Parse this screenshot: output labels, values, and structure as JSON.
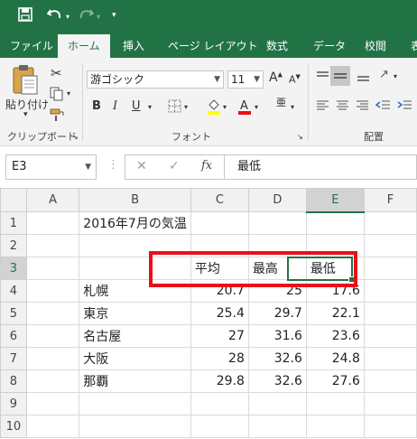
{
  "qat": {
    "save_icon": "save-icon",
    "undo_icon": "undo-icon",
    "redo_icon": "redo-icon",
    "customize_icon": "customize-icon"
  },
  "tabs": [
    {
      "label": "ファイル"
    },
    {
      "label": "ホーム"
    },
    {
      "label": "挿入"
    },
    {
      "label": "ページ レイアウト"
    },
    {
      "label": "数式"
    },
    {
      "label": "データ"
    },
    {
      "label": "校閲"
    },
    {
      "label": "表"
    }
  ],
  "ribbon": {
    "clipboard": {
      "paste_label": "貼り付け",
      "group_label": "クリップボード"
    },
    "font": {
      "font_name": "游ゴシック",
      "font_size": "11",
      "group_label": "フォント",
      "bold": "B",
      "italic": "I",
      "underline": "U",
      "grow": "A",
      "shrink": "A",
      "phonetic": "亜"
    },
    "alignment": {
      "group_label": "配置"
    }
  },
  "formula_bar": {
    "name_box": "E3",
    "cancel": "✕",
    "enter": "✓",
    "fx": "fx",
    "content": "最低"
  },
  "sheet": {
    "columns": [
      "A",
      "B",
      "C",
      "D",
      "E",
      "F"
    ],
    "rows": [
      "1",
      "2",
      "3",
      "4",
      "5",
      "6",
      "7",
      "8",
      "9",
      "10"
    ],
    "title": "2016年7月の気温",
    "headers": [
      "平均",
      "最高",
      "最低"
    ],
    "data": [
      {
        "city": "札幌",
        "avg": "20.7",
        "max": "25",
        "min": "17.6"
      },
      {
        "city": "東京",
        "avg": "25.4",
        "max": "29.7",
        "min": "22.1"
      },
      {
        "city": "名古屋",
        "avg": "27",
        "max": "31.6",
        "min": "23.6"
      },
      {
        "city": "大阪",
        "avg": "28",
        "max": "32.6",
        "min": "24.8"
      },
      {
        "city": "那覇",
        "avg": "29.8",
        "max": "32.6",
        "min": "27.6"
      }
    ]
  },
  "colors": {
    "accent": "#217346",
    "highlight": "#e8101a"
  }
}
